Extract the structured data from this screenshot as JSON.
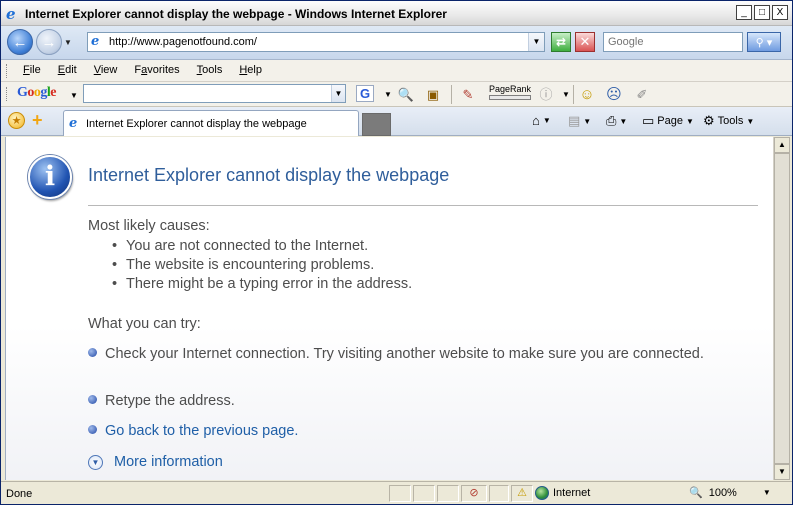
{
  "window": {
    "title": "Internet Explorer cannot display the webpage - Windows Internet Explorer",
    "app_icon": "ie-logo-icon",
    "buttons": {
      "minimize": "_",
      "maximize": "□",
      "close": "X"
    }
  },
  "address": {
    "url": "http://www.pagenotfound.com/",
    "search_placeholder": "Google"
  },
  "menu": {
    "items": [
      {
        "label": "File",
        "accel": "F",
        "rest": "ile"
      },
      {
        "label": "Edit",
        "accel": "E",
        "rest": "dit"
      },
      {
        "label": "View",
        "accel": "V",
        "rest": "iew"
      },
      {
        "label": "Favorites",
        "accel": "a",
        "pre": "F",
        "rest": "vorites"
      },
      {
        "label": "Tools",
        "accel": "T",
        "rest": "ools"
      },
      {
        "label": "Help",
        "accel": "H",
        "rest": "elp"
      }
    ]
  },
  "google_toolbar": {
    "logo": [
      "G",
      "o",
      "o",
      "g",
      "l",
      "e"
    ],
    "pagerank_label": "PageRank"
  },
  "tabs": {
    "active_label": "Internet Explorer cannot display the webpage"
  },
  "commands": {
    "page": "Page",
    "tools": "Tools"
  },
  "content": {
    "heading": "Internet Explorer cannot display the webpage",
    "causes_title": "Most likely causes:",
    "causes": [
      "You are not connected to the Internet.",
      "The website is encountering problems.",
      "There might be a typing error in the address."
    ],
    "try_title": "What you can try:",
    "try_items": [
      {
        "text": "Check your Internet connection. Try visiting another website to make sure you are connected."
      },
      {
        "text": "Retype the address."
      },
      {
        "text": "Go back to the previous page."
      }
    ],
    "more_info": "More information"
  },
  "status": {
    "text": "Done",
    "zone": "Internet",
    "zoom": "100%"
  },
  "colors": {
    "heading": "#2f5e9b",
    "link": "#1f5fa7",
    "body_text": "#4d4d4d"
  }
}
